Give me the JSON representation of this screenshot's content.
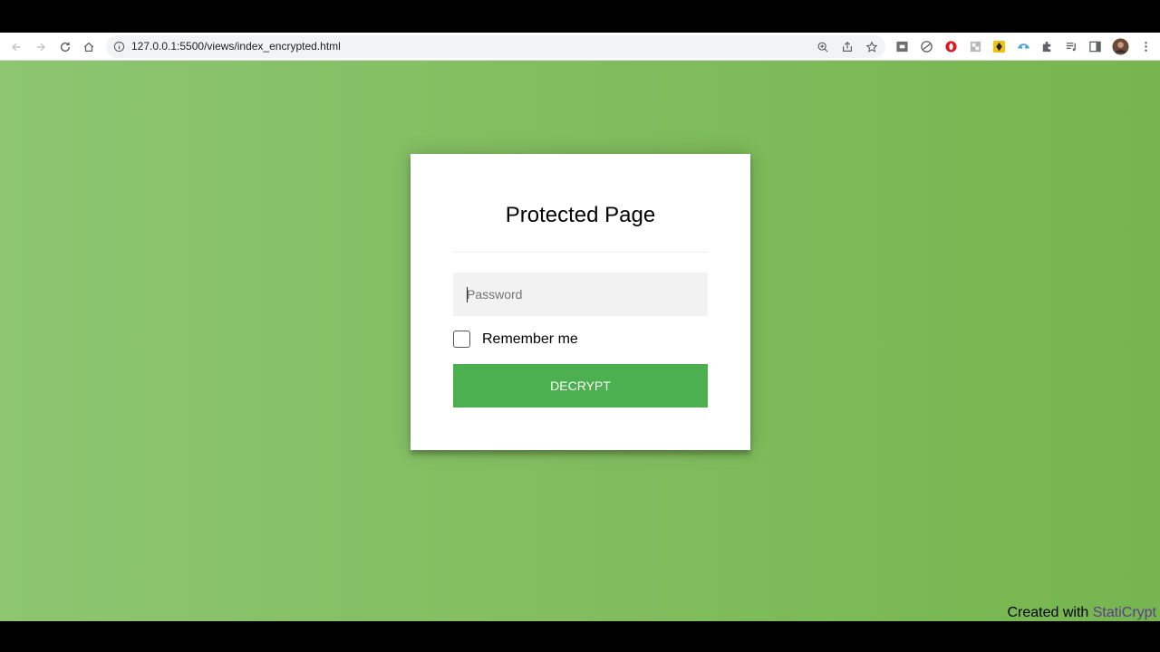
{
  "browser": {
    "url": "127.0.0.1:5500/views/index_encrypted.html",
    "icons": {
      "back": "back-arrow-icon",
      "forward": "forward-arrow-icon",
      "reload": "reload-icon",
      "home": "home-icon",
      "site_info": "info-icon",
      "zoom": "zoom-icon",
      "share": "share-icon",
      "bookmark": "star-icon",
      "extensions": [
        "extension-icon",
        "extension-icon",
        "opera-icon",
        "extension-icon",
        "extension-icon",
        "extension-icon",
        "puzzle-icon",
        "media-icon",
        "side-panel-icon",
        "avatar",
        "more-menu-icon"
      ]
    }
  },
  "page": {
    "background_color": "#84bf62",
    "card": {
      "title": "Protected Page",
      "password_placeholder": "Password",
      "password_value": "",
      "remember_label": "Remember me",
      "remember_checked": false,
      "submit_label": "DECRYPT",
      "button_color": "#4caf50"
    },
    "footer": {
      "prefix": "Created with ",
      "link_text": "StatiCrypt"
    }
  }
}
